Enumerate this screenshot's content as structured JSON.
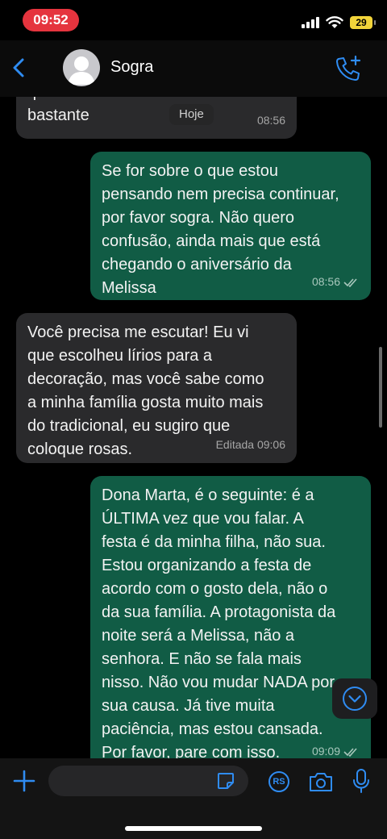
{
  "status_bar": {
    "time": "09:52",
    "battery": "29"
  },
  "header": {
    "contact_name": "Sogra"
  },
  "chat": {
    "date_chip": "Hoje",
    "messages": [
      {
        "direction": "in",
        "text": "que andam me incomodando\nbastante",
        "time": "08:56"
      },
      {
        "direction": "out",
        "text": "Se for sobre o que estou\npensando nem precisa continuar,\npor favor sogra. Não quero\nconfusão, ainda mais que está\nchegando o aniversário da\nMelissa",
        "time": "08:56"
      },
      {
        "direction": "in",
        "text": "Você precisa me escutar! Eu vi\nque escolheu lírios para a\ndecoração, mas você sabe como\na minha família gosta muito mais\ndo tradicional, eu sugiro que\ncoloque rosas.",
        "time": "Editada 09:06"
      },
      {
        "direction": "out",
        "text": "Dona Marta, é o seguinte: é a\nÚLTIMA vez que vou falar. A\nfesta é da minha filha, não sua.\nEstou organizando a festa de\nacordo com o gosto dela, não o\nda sua família. A protagonista da\nnoite será a Melissa, não a\nsenhora. E não se fala mais\nnisso. Não vou mudar NADA por\nsua causa. Já tive muita\npaciência, mas estou cansada.\nPor favor, pare com isso.",
        "time": "09:09"
      }
    ]
  },
  "input_bar": {
    "placeholder": "",
    "value": "",
    "rs_label": "RS"
  },
  "colors": {
    "incoming_bubble": "#2a2a2c",
    "outgoing_bubble": "#115c45",
    "accent": "#2f8cf2",
    "time_pill": "#e5343e"
  }
}
